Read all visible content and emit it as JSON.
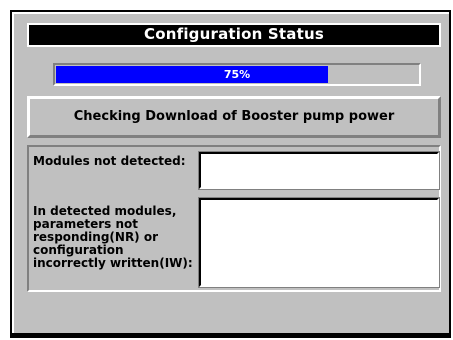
{
  "dialog": {
    "title": "Configuration Status"
  },
  "progress": {
    "label": "75%",
    "value": 0.75
  },
  "status": {
    "message": "Checking Download of Booster pump power"
  },
  "results": {
    "modules_not_detected_label": "Modules not detected:",
    "modules_not_detected_value": "",
    "nr_iw_label": "In detected modules,\nparameters not\nresponding(NR) or\nconfiguration\nincorrectly written(IW):",
    "nr_iw_value": ""
  },
  "colors": {
    "title_background": "#000000",
    "progress_fill": "#0000ff",
    "panel_face": "#c0c0c0"
  }
}
